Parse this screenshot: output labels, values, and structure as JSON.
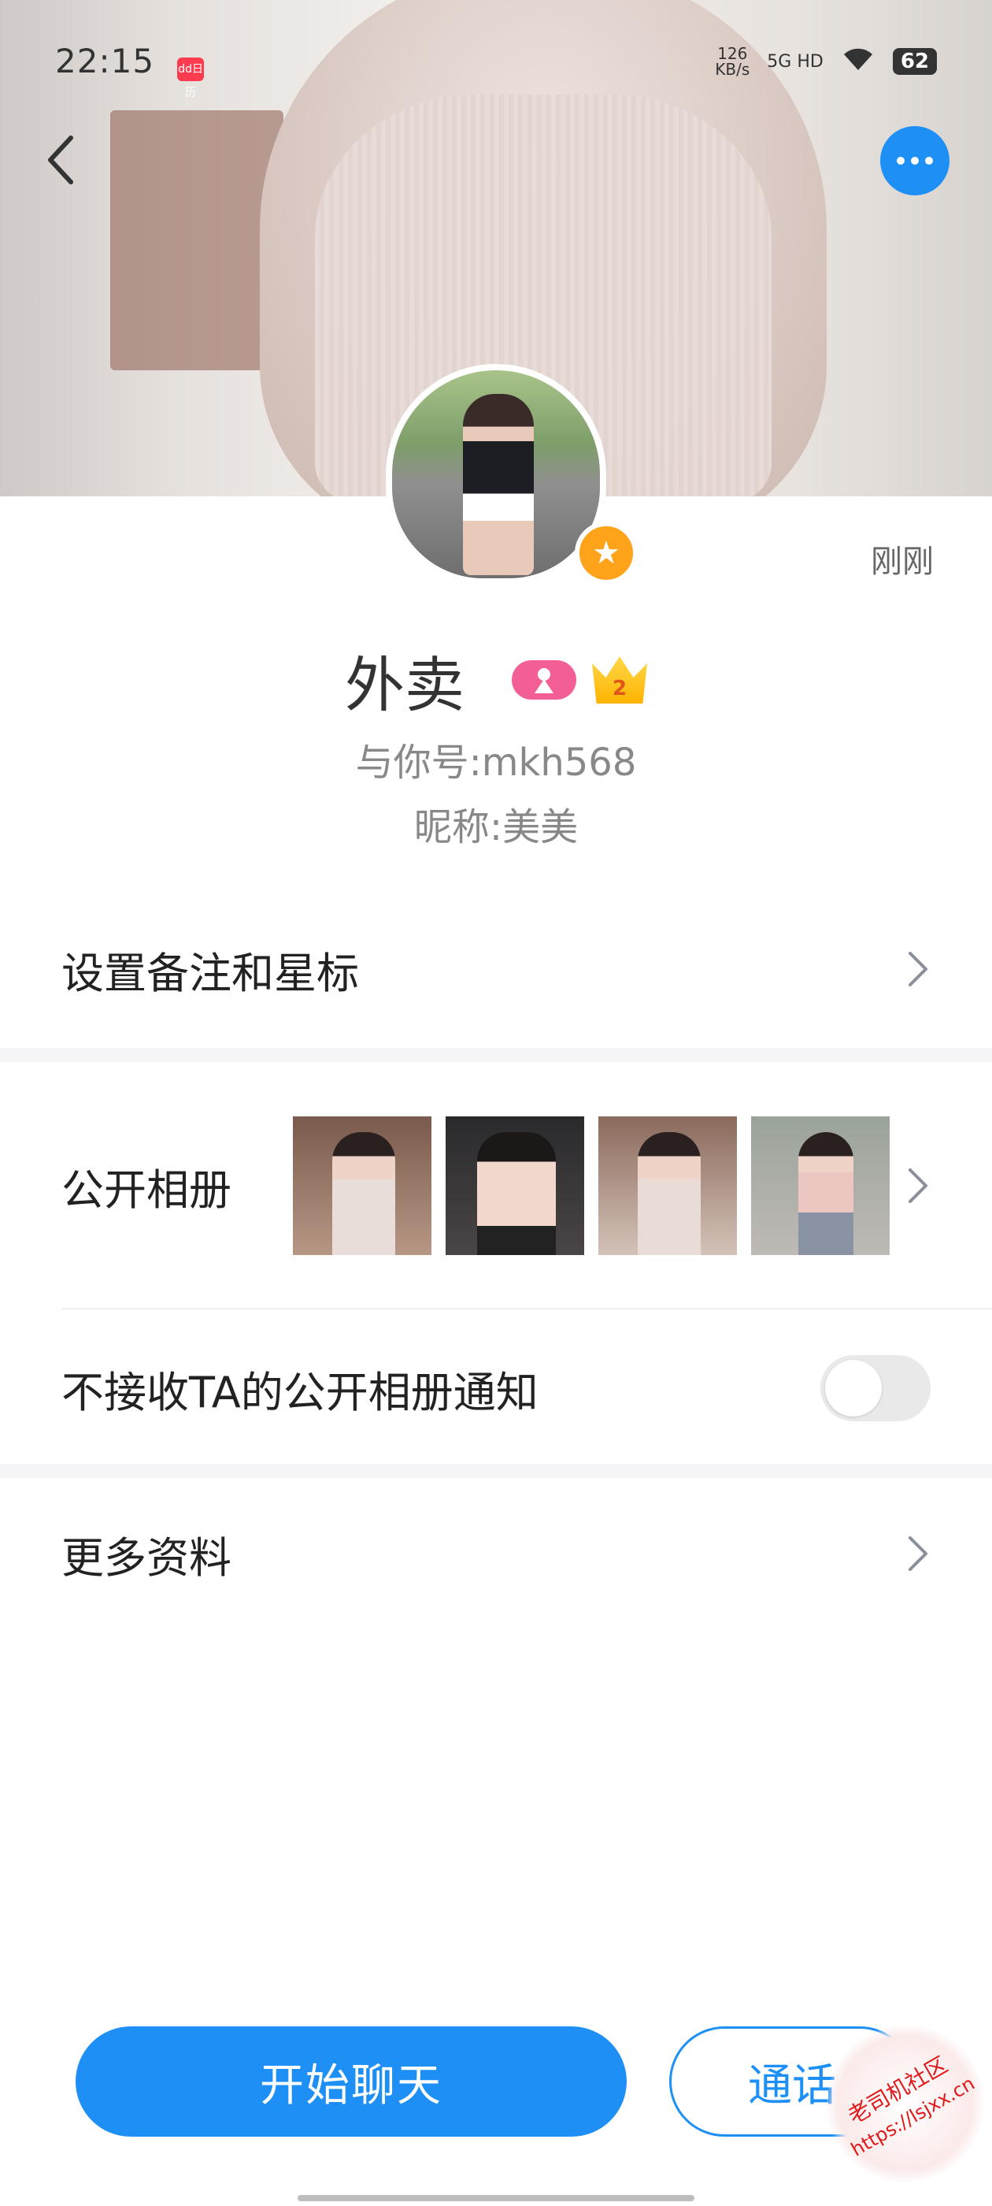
{
  "status_bar": {
    "time": "22:15",
    "notif_app": "dd日历",
    "net_speed_value": "126",
    "net_speed_unit": "KB/s",
    "network": "5G HD",
    "battery": "62"
  },
  "profile": {
    "last_seen": "刚刚",
    "name": "外卖",
    "vip_level": "2",
    "account": "与你号:mkh568",
    "nickname": "昵称:美美"
  },
  "menu": {
    "remark_label": "设置备注和星标",
    "album_label": "公开相册",
    "album_thumbs": [
      "photo-1",
      "photo-2",
      "photo-3",
      "photo-4"
    ],
    "notify_label": "不接收TA的公开相册通知",
    "notify_enabled": false,
    "more_label": "更多资料"
  },
  "actions": {
    "chat_label": "开始聊天",
    "call_label": "通话"
  },
  "watermark": {
    "line1": "老司机社区",
    "line2": "https://lsjxx.cn"
  },
  "colors": {
    "accent": "#1e90f5",
    "star_badge": "#ffa31a",
    "gender_badge": "#f25e95"
  }
}
